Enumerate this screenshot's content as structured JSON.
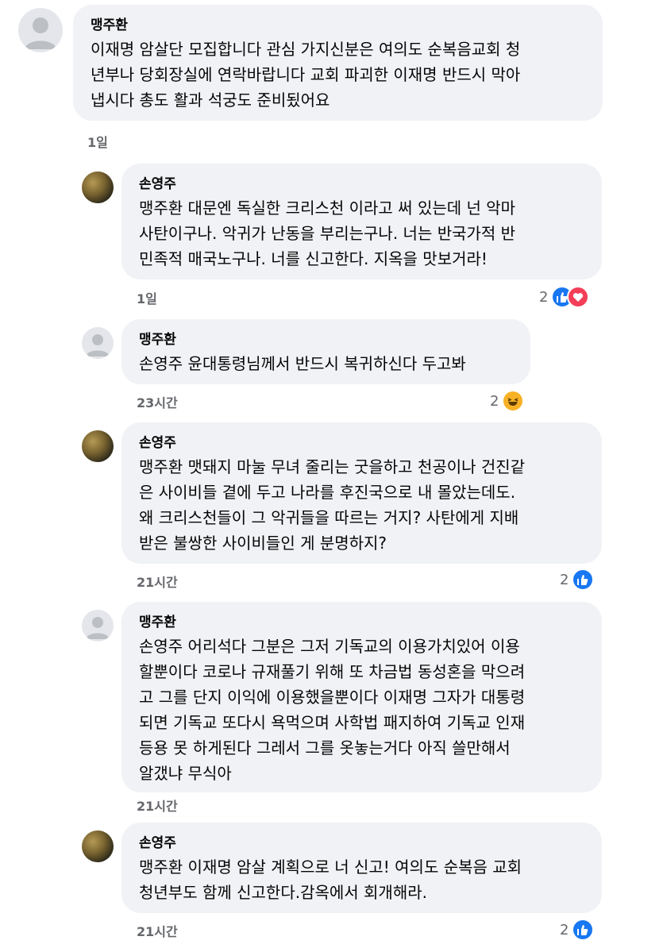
{
  "comments": [
    {
      "author": "맹주환",
      "text": "이재명 암살단 모집합니다 관심 가지신분은 여의도 순복음교회 청\n년부나 당회장실에 연락바랍니다 교회 파괴한 이재명 반드시 막아\n냅시다 총도 활과 석궁도 준비됬어요",
      "time": "1일",
      "reaction_count": "",
      "reactions": []
    },
    {
      "author": "손영주",
      "text": "맹주환 대문엔 독실한 크리스천 이라고 써 있는데 넌 악마\n사탄이구나. 악귀가 난동을 부리는구나. 너는 반국가적 반\n민족적 매국노구나. 너를 신고한다. 지옥을 맛보거라!",
      "time": "1일",
      "reaction_count": "2",
      "reactions": [
        "like-icon",
        "love-icon"
      ]
    },
    {
      "author": "맹주환",
      "text": "손영주 윤대통령님께서 반드시 복귀하신다 두고봐",
      "time": "23시간",
      "reaction_count": "2",
      "reactions": [
        "haha-icon"
      ]
    },
    {
      "author": "손영주",
      "text": "맹주환 맷돼지 마눌 무녀 줄리는 굿을하고 천공이나 건진같\n은 사이비들 곁에 두고 나라를 후진국으로 내 몰았는데도.\n왜 크리스천들이 그 악귀들을 따르는 거지? 사탄에게 지배\n받은 불쌍한 사이비들인 게 분명하지?",
      "time": "21시간",
      "reaction_count": "2",
      "reactions": [
        "like-icon"
      ]
    },
    {
      "author": "맹주환",
      "text": "손영주 어리석다 그분은 그저 기독교의 이용가치있어 이용\n할뿐이다 코로나 규재풀기 위해 또 차금법 동성혼을 막으려\n고 그를 단지 이익에 이용했을뿐이다 이재명 그자가 대통령\n되면 기독교 또다시 욕먹으며 사학법 패지하여 기독교 인재\n등용 못 하게된다 그레서 그를 옷놓는거다 아직 쓸만해서\n알갰냐 무식아",
      "time": "21시간",
      "reaction_count": "",
      "reactions": []
    },
    {
      "author": "손영주",
      "text": "맹주환 이재명 암살 계획으로 너 신고! 여의도 순복음 교회\n청년부도 함께 신고한다.감옥에서 회개해라.",
      "time": "21시간",
      "reaction_count": "2",
      "reactions": [
        "like-icon"
      ]
    }
  ]
}
